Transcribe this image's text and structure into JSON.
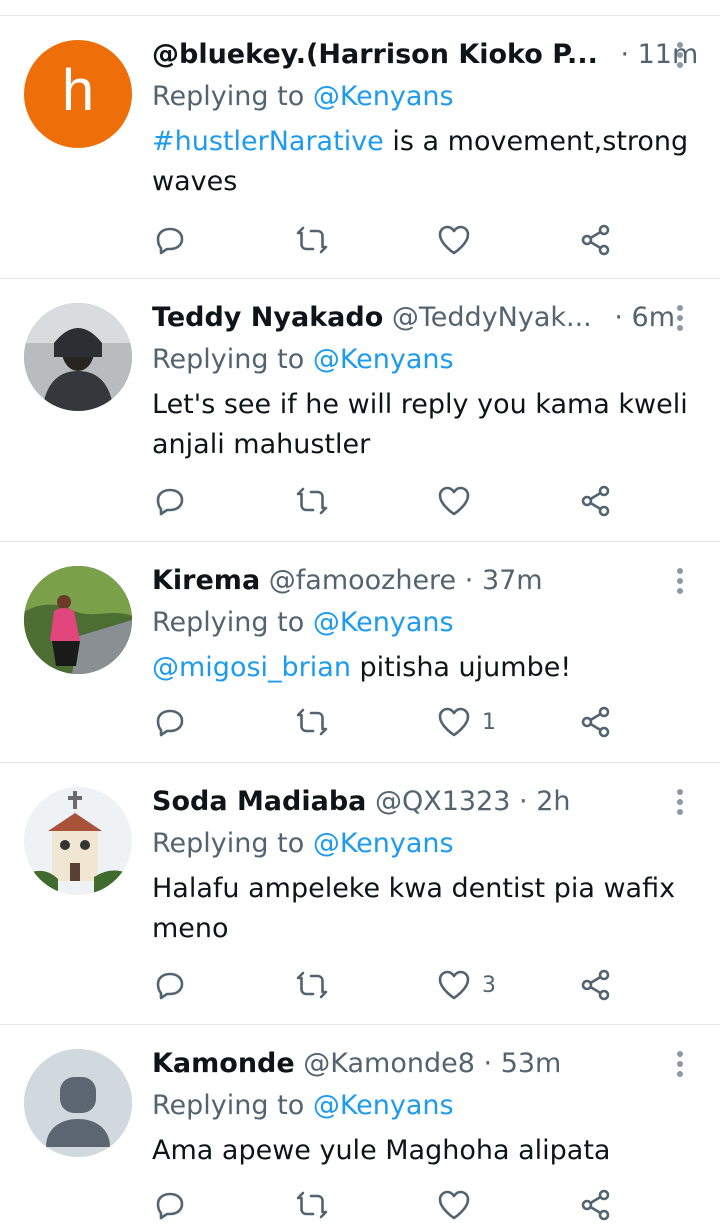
{
  "replying_label": "Replying to",
  "colors": {
    "accent": "#1d9bf0",
    "text": "#0f1419",
    "muted": "#536471",
    "divider": "#e3e6e8",
    "avatar_h_bg": "#ee6f09"
  },
  "tweets": [
    {
      "name": "@bluekey.(Harrison Kioko P...",
      "handle": "",
      "dot": "·",
      "time": "11m",
      "reply_to": "@Kenyans",
      "text_prefix": "",
      "text_hashtag": "#hustlerNarative",
      "text_main": " is a movement,strong waves",
      "avatar": {
        "type": "letter",
        "letter": "h"
      },
      "like_count": ""
    },
    {
      "name": "Teddy Nyakado",
      "handle": "@TeddyNyak...",
      "dot": "·",
      "time": "6m",
      "reply_to": "@Kenyans",
      "text_hashtag": "",
      "text_main": "Let's see if he will reply you kama kweli anjali mahustler",
      "avatar": {
        "type": "photo",
        "icon": "person-photo"
      },
      "like_count": ""
    },
    {
      "name": "Kirema",
      "handle": "@famoozhere",
      "dot": "·",
      "time": "37m",
      "reply_to": "@Kenyans",
      "text_hashtag": "@migosi_brian",
      "text_main": " pitisha ujumbe!",
      "avatar": {
        "type": "photo",
        "icon": "person-photo"
      },
      "like_count": "1"
    },
    {
      "name": "Soda Madiaba",
      "handle": "@QX1323",
      "dot": "·",
      "time": "2h",
      "reply_to": "@Kenyans",
      "text_hashtag": "",
      "text_main": "Halafu ampeleke kwa dentist pia wafix meno",
      "avatar": {
        "type": "photo",
        "icon": "church-photo"
      },
      "like_count": "3"
    },
    {
      "name": "Kamonde",
      "handle": "@Kamonde8",
      "dot": "·",
      "time": "53m",
      "reply_to": "@Kenyans",
      "text_hashtag": "",
      "text_main": "Ama apewe yule Maghoha alipata",
      "avatar": {
        "type": "default",
        "icon": "default-user-icon"
      },
      "like_count": ""
    }
  ]
}
